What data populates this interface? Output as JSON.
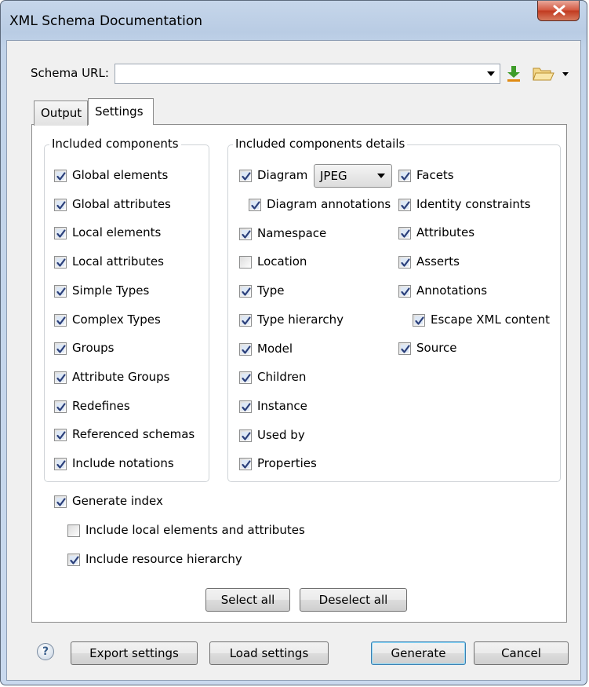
{
  "window": {
    "title": "XML Schema Documentation"
  },
  "schema": {
    "label": "Schema URL:",
    "value": ""
  },
  "tabs": [
    {
      "label": "Output",
      "active": false
    },
    {
      "label": "Settings",
      "active": true
    }
  ],
  "included_components": {
    "title": "Included components",
    "items": [
      {
        "label": "Global elements",
        "checked": true
      },
      {
        "label": "Global attributes",
        "checked": true
      },
      {
        "label": "Local elements",
        "checked": true
      },
      {
        "label": "Local attributes",
        "checked": true
      },
      {
        "label": "Simple Types",
        "checked": true
      },
      {
        "label": "Complex Types",
        "checked": true
      },
      {
        "label": "Groups",
        "checked": true
      },
      {
        "label": "Attribute Groups",
        "checked": true
      },
      {
        "label": "Redefines",
        "checked": true
      },
      {
        "label": "Referenced schemas",
        "checked": true
      },
      {
        "label": "Include notations",
        "checked": true
      }
    ]
  },
  "details": {
    "title": "Included components details",
    "diagram": {
      "label": "Diagram",
      "checked": true,
      "format": "JPEG"
    },
    "left": [
      {
        "label": "Diagram annotations",
        "checked": true
      },
      {
        "label": "Namespace",
        "checked": true
      },
      {
        "label": "Location",
        "checked": false
      },
      {
        "label": "Type",
        "checked": true
      },
      {
        "label": "Type hierarchy",
        "checked": true
      },
      {
        "label": "Model",
        "checked": true
      },
      {
        "label": "Children",
        "checked": true
      },
      {
        "label": "Instance",
        "checked": true
      },
      {
        "label": "Used by",
        "checked": true
      },
      {
        "label": "Properties",
        "checked": true
      }
    ],
    "right": [
      {
        "label": "Facets",
        "checked": true
      },
      {
        "label": "Identity constraints",
        "checked": true
      },
      {
        "label": "Attributes",
        "checked": true
      },
      {
        "label": "Asserts",
        "checked": true
      },
      {
        "label": "Annotations",
        "checked": true
      },
      {
        "label": "Escape XML content",
        "checked": true
      },
      {
        "label": "Source",
        "checked": true
      }
    ]
  },
  "index": {
    "generate": {
      "label": "Generate index",
      "checked": true
    },
    "local": {
      "label": "Include local elements and attributes",
      "checked": false
    },
    "resource": {
      "label": "Include resource hierarchy",
      "checked": true
    }
  },
  "buttons": {
    "select_all": "Select all",
    "deselect_all": "Deselect all",
    "export": "Export settings",
    "load": "Load settings",
    "generate": "Generate",
    "cancel": "Cancel"
  },
  "icons": {
    "help": "?",
    "download": "download-arrow-icon",
    "folder": "open-folder-icon"
  },
  "colors": {
    "title_bar": "#c1d3e9",
    "close_button": "#c7452a",
    "check_mark": "#2b3f7a"
  }
}
